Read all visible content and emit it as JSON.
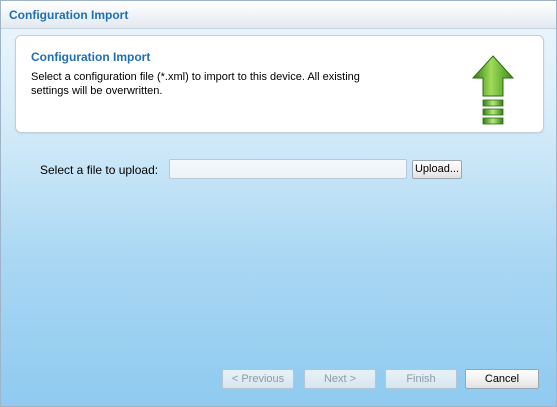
{
  "window": {
    "title": "Configuration Import"
  },
  "info_panel": {
    "heading": "Configuration Import",
    "description": "Select a configuration file (*.xml) to import to this device. All existing settings will be overwritten.",
    "icon": "upload-arrow-icon"
  },
  "file_upload": {
    "label": "Select a file to upload:",
    "value": "",
    "button_label": "Upload..."
  },
  "wizard_buttons": {
    "previous": "< Previous",
    "next": "Next >",
    "finish": "Finish",
    "cancel": "Cancel"
  },
  "colors": {
    "accent": "#1f6fb7",
    "arrow_green": "#3f9a1f"
  }
}
